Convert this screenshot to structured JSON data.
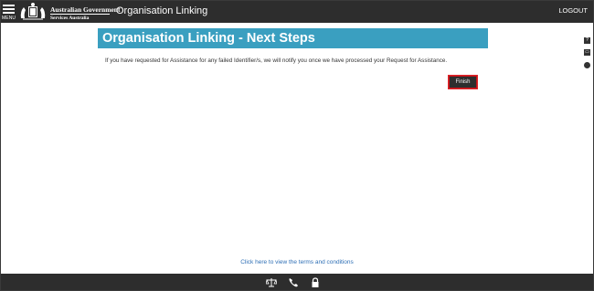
{
  "header": {
    "menu_label": "MENU",
    "gov_name": "Australian Government",
    "gov_sub": "Services Australia",
    "app_title": "Organisation Linking",
    "logout_label": "LOGOUT",
    "bg_color": "#2d2d2d"
  },
  "side_tools": [
    {
      "icon": "help-icon",
      "glyph": "?"
    },
    {
      "icon": "print-icon",
      "glyph": "▭"
    },
    {
      "icon": "chat-icon",
      "glyph": ""
    }
  ],
  "main": {
    "heading": "Organisation Linking - Next Steps",
    "heading_color": "#3a9fc0",
    "message": "If you have requested for Assistance for any failed Identifier/s, we will notify you once we have processed your Request for Assistance.",
    "finish_label": "Finish"
  },
  "footer": {
    "terms_link": "Click here to view the terms and conditions",
    "icons": [
      "scales-icon",
      "phone-icon",
      "lock-icon"
    ]
  }
}
